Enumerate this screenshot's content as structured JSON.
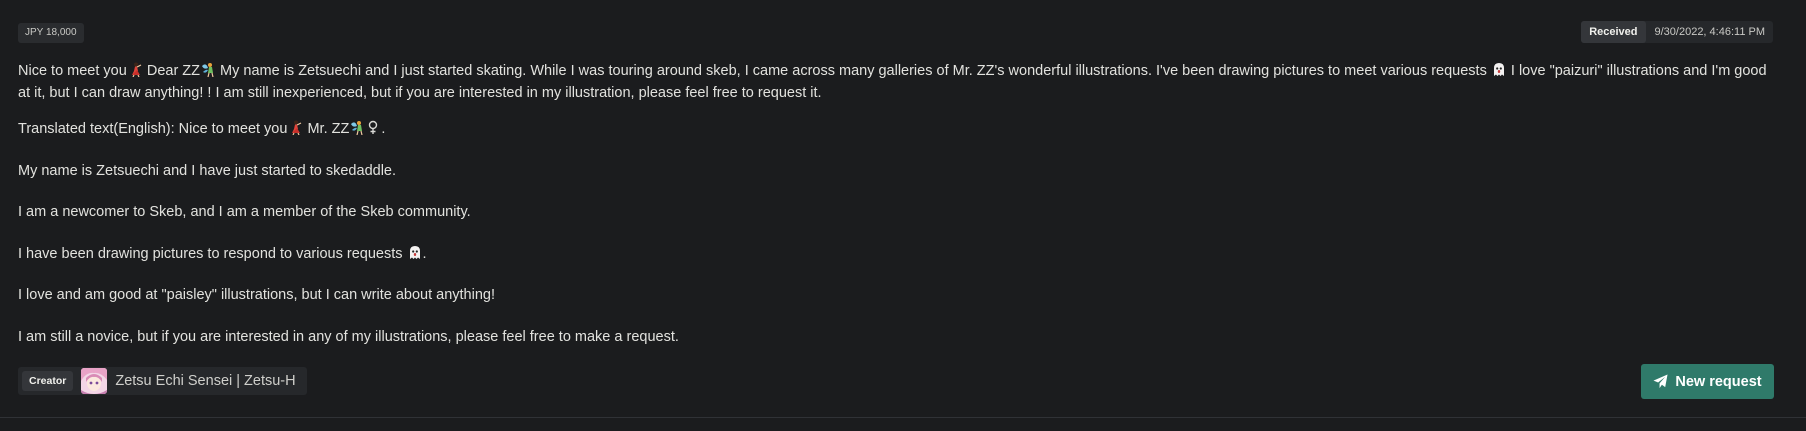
{
  "card": {
    "price": "JPY 18,000",
    "status": "Received",
    "timestamp": "9/30/2022, 4:46:11 PM",
    "original_text": {
      "part1": "Nice to meet you",
      "emoji1": "dancer-emoji",
      "part2": " Dear ZZ",
      "emoji2": "fairy-emoji",
      "part3": " My name is Zetsuechi and I just started skating. While I was touring around skeb, I came across many galleries of Mr. ZZ's wonderful illustrations. I've been drawing pictures to meet various requests ",
      "emoji3": "ghost-emoji",
      "part4": " I love \"paizuri\" illustrations and I'm good at it, but I can draw anything! ! I am still inexperienced, but if you are interested in my illustration, please feel free to request it."
    },
    "translated_text": {
      "line1_a": "Translated text(English): Nice to meet you",
      "line1_b": " Mr. ZZ",
      "line1_c": ".",
      "line2": "My name is Zetsuechi and I have just started to skedaddle.",
      "line3": "I am a newcomer to Skeb, and I am a member of the Skeb community.",
      "line4_a": "I have been drawing pictures to respond to various requests ",
      "line4_b": ".",
      "line5": "I love and am good at \"paisley\" illustrations, but I can write about anything!",
      "line6": "I am still a novice, but if you are interested in any of my illustrations, please feel free to make a request."
    },
    "creator": {
      "label": "Creator",
      "name": "Zetsu Echi Sensei | Zetsu-H",
      "avatar_icon": "creator-avatar"
    },
    "new_request": {
      "label": "New request",
      "icon": "paper-plane-icon"
    },
    "colors": {
      "background": "#1b1c1e",
      "accent_button": "#2f7a6a",
      "badge": "#34363a",
      "text": "#e2e2de"
    }
  }
}
